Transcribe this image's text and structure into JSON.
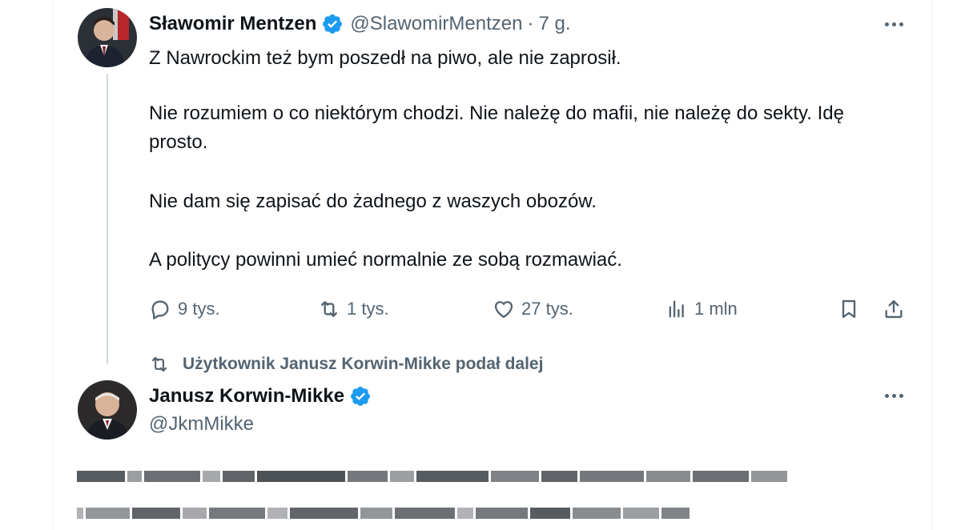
{
  "tweet": {
    "author": {
      "display_name": "Sławomir Mentzen",
      "handle": "@SlawomirMentzen",
      "verified": true,
      "avatar_icon": "avatar-photo"
    },
    "separator": "·",
    "time": "7 g.",
    "paragraphs": [
      "Z Nawrockim też bym poszedł na piwo, ale nie zaprosił.",
      "Nie rozumiem o co niektórym chodzi. Nie należę do mafii, nie należę do sekty. Idę prosto.",
      "Nie dam się zapisać do żadnego z waszych obozów.",
      "A politycy powinni umieć normalnie ze sobą rozmawiać."
    ],
    "actions": {
      "replies": "9 tys.",
      "retweets": "1 tys.",
      "likes": "27 tys.",
      "views": "1 mln"
    }
  },
  "retweet_context": {
    "text": "Użytkownik Janusz Korwin-Mikke podał dalej",
    "icon": "retweet-icon"
  },
  "tweet2": {
    "author": {
      "display_name": "Janusz Korwin-Mikke",
      "handle": "@JkmMikke",
      "verified": true,
      "avatar_icon": "avatar-photo"
    }
  },
  "colors": {
    "text_primary": "#0f1419",
    "text_secondary": "#536471",
    "verified_blue": "#1d9bf0",
    "thread_line": "#cfd9de",
    "border": "#eff3f4"
  }
}
